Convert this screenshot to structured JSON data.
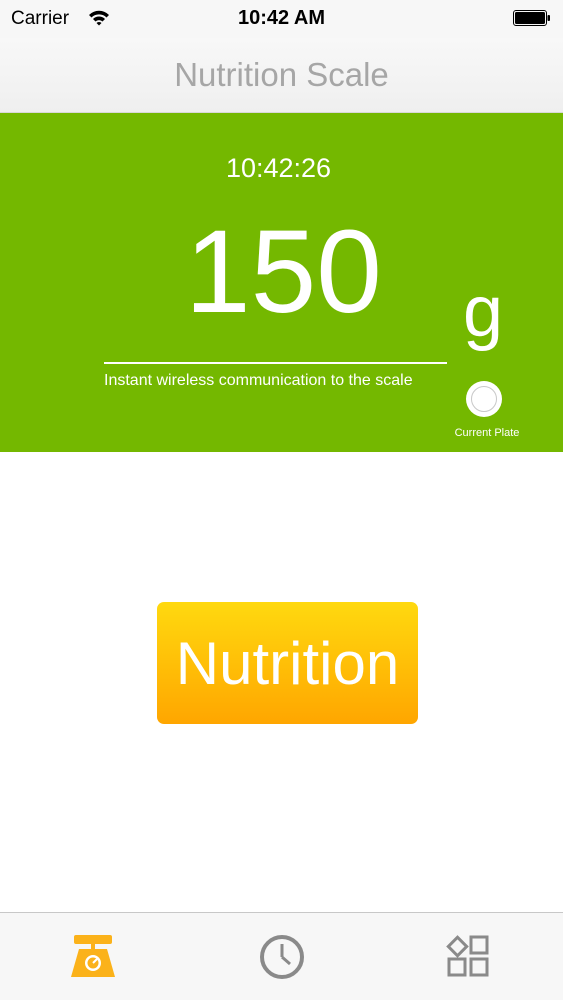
{
  "status_bar": {
    "carrier": "Carrier",
    "time": "10:42 AM"
  },
  "nav": {
    "title": "Nutrition Scale"
  },
  "scale": {
    "reading_time": "10:42:26",
    "weight": "150",
    "unit": "g",
    "caption": "Instant wireless communication to the scale",
    "plate_label": "Current Plate"
  },
  "main": {
    "nutrition_button": "Nutrition"
  },
  "tab_bar": {
    "tabs": [
      {
        "icon": "scale-icon",
        "selected": true
      },
      {
        "icon": "clock-icon",
        "selected": false
      },
      {
        "icon": "grid-icon",
        "selected": false
      }
    ]
  },
  "colors": {
    "panel_green": "#74b800",
    "button_gradient_top": "#ffd90f",
    "button_gradient_bottom": "#ffa600",
    "tab_active": "#fbb21a",
    "tab_inactive": "#8a8a8a"
  }
}
